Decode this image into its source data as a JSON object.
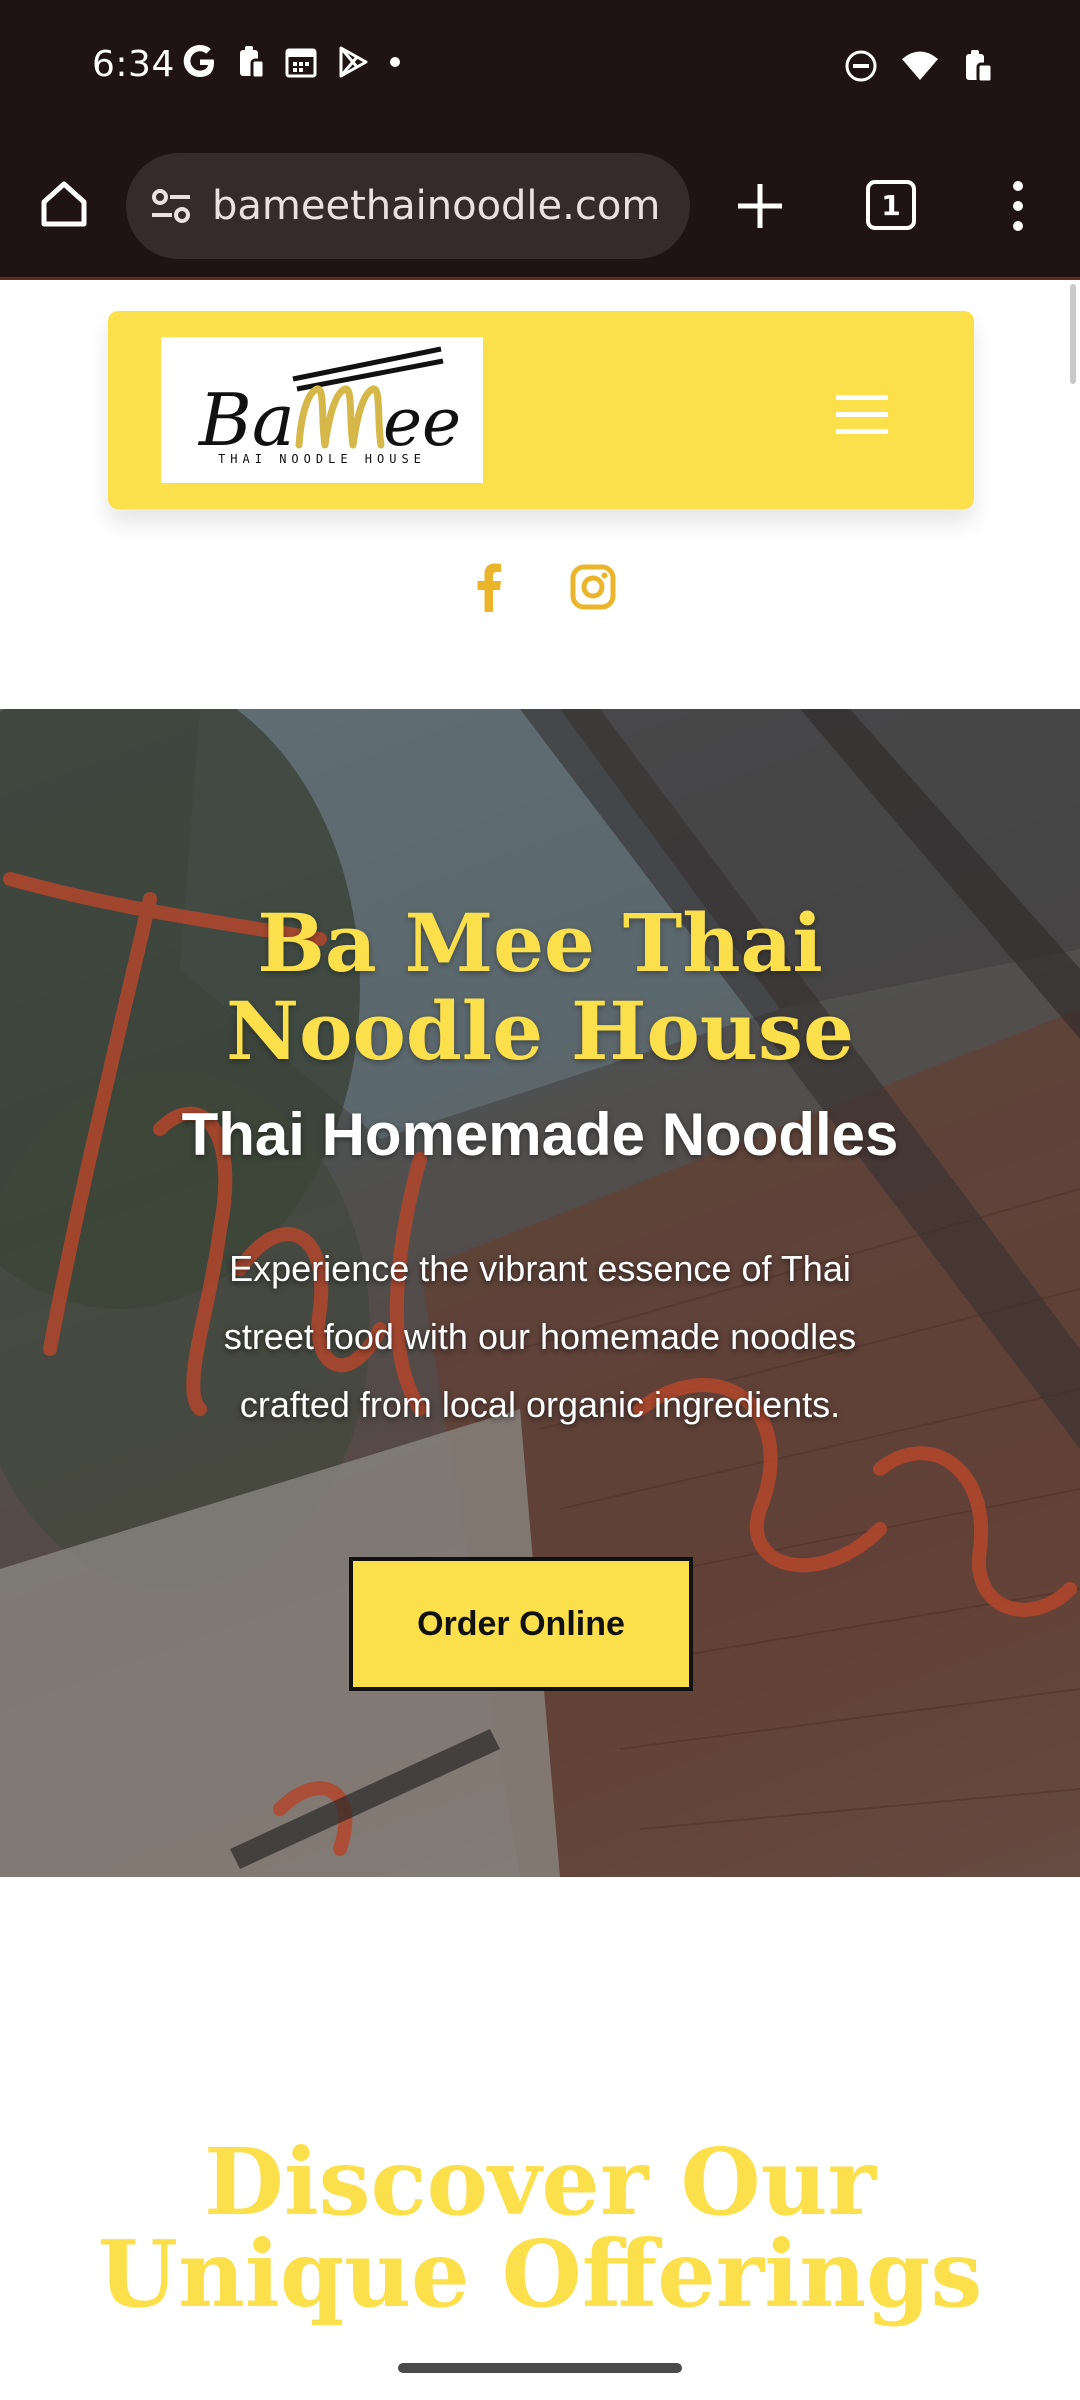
{
  "status_bar": {
    "time": "6:34",
    "left_icons": [
      "google-icon",
      "clipboard-icon",
      "calendar-icon",
      "play-store-icon",
      "dot-icon"
    ],
    "right_icons": [
      "do-not-disturb-icon",
      "wifi-icon",
      "battery-icon"
    ]
  },
  "browser": {
    "url": "bameethainoodle.com",
    "tab_count": "1"
  },
  "header": {
    "logo_text": "BaMee",
    "logo_tagline": "Thai Noodle House"
  },
  "social": [
    "facebook-icon",
    "instagram-icon"
  ],
  "hero": {
    "title": "Ba Mee Thai Noodle House",
    "subtitle": "Thai Homemade Noodles",
    "description": "Experience the vibrant essence of Thai street food with our homemade noodles crafted from local organic ingredients.",
    "cta_label": "Order Online"
  },
  "offerings": {
    "title": "Discover Our Unique Offerings"
  },
  "colors": {
    "brand_yellow": "#fbe04c",
    "browser_chrome": "#1f1314",
    "url_pill": "#372a2a",
    "social_icon": "#eab52a"
  }
}
